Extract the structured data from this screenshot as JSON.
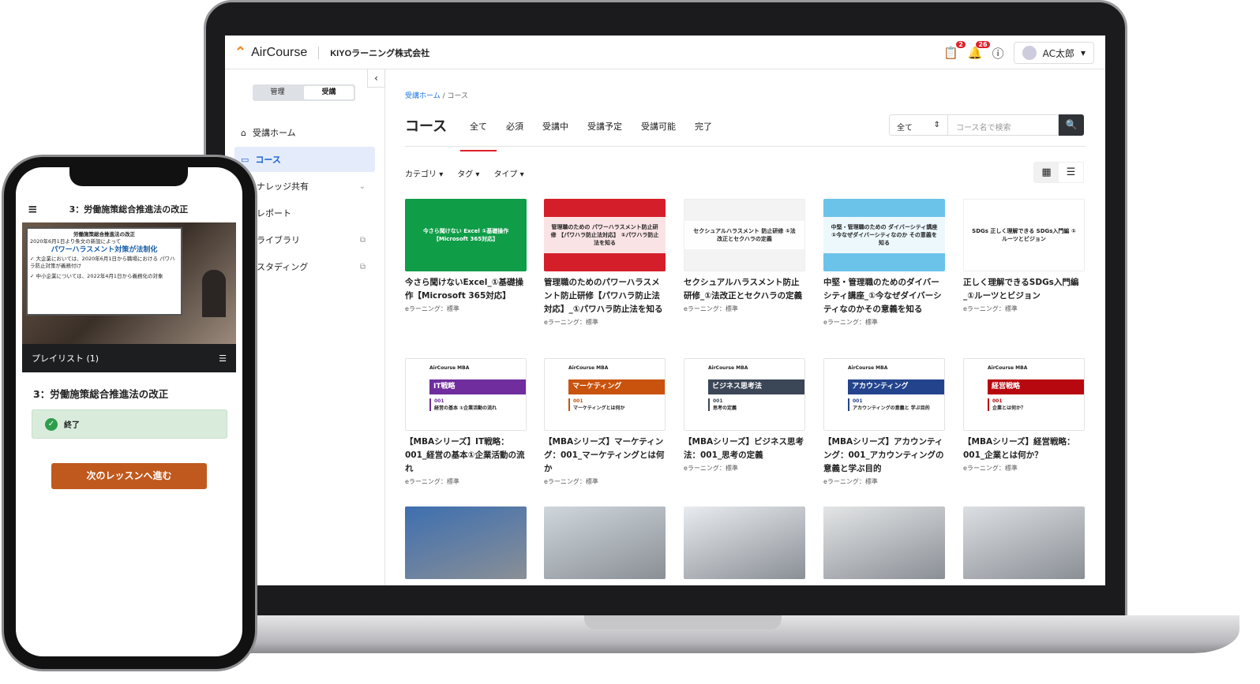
{
  "app": {
    "brand": "AirCourse",
    "company": "KIYOラーニング株式会社",
    "user": "AC太郎",
    "tasks_badge": "2",
    "notifications_badge": "26"
  },
  "sidebar": {
    "mode_admin": "管理",
    "mode_learner": "受講",
    "items": [
      {
        "label": "受講ホーム",
        "icon": "home-icon"
      },
      {
        "label": "コース",
        "icon": "monitor-icon",
        "active": true
      },
      {
        "label": "ナレッジ共有",
        "icon": "chevron-down-icon"
      },
      {
        "label": "レポート"
      },
      {
        "label": "ライブラリ",
        "icon": "external-link-icon"
      },
      {
        "label": "スタディング",
        "icon": "external-link-icon"
      }
    ]
  },
  "main": {
    "breadcrumb": {
      "home": "受講ホーム",
      "current": "コース"
    },
    "title": "コース",
    "tabs": [
      "全て",
      "必須",
      "受講中",
      "受講予定",
      "受講可能",
      "完了"
    ],
    "active_tab": "全て",
    "search": {
      "scope": "全て",
      "placeholder": "コース名で検索"
    },
    "filters": [
      "カテゴリ",
      "タグ",
      "タイプ"
    ],
    "courses": [
      {
        "title": "今さら聞けないExcel_①基礎操作【Microsoft 365対応】",
        "type": "eラーニング：標準",
        "thumb_text": "今さら聞けない Excel ①基礎操作 【Microsoft 365対応】",
        "color": "#0f9d48"
      },
      {
        "title": "管理職のためのパワーハラスメント防止研修【パワハラ防止法対応】_①パワハラ防止法を知る",
        "type": "eラーニング：標準",
        "thumb_text": "管理職のための パワーハラスメント防止研修 【パワハラ防止法対応】 ①パワハラ防止法を知る",
        "color": "#d41f2b"
      },
      {
        "title": "セクシュアルハラスメント防止研修_①法改正とセクハラの定義",
        "type": "eラーニング：標準",
        "thumb_text": "セクシュアルハラスメント 防止研修 ①法改正とセクハラの定義",
        "color": "#f3f3f3"
      },
      {
        "title": "中堅・管理職のためのダイバーシティ講座_①今なぜダイバーシティなのかその意義を知る",
        "type": "eラーニング：標準",
        "thumb_text": "中堅・管理職のための ダイバーシティ講座 ①今なぜダイバーシティなのか その意義を知る",
        "color": "#6cc3ea"
      },
      {
        "title": "正しく理解できるSDGs入門編_①ルーツとビジョン",
        "type": "eラーニング：標準",
        "thumb_text": "SDGs 正しく理解できる SDGs入門編 ①ルーツとビジョン",
        "color": "#ffffff"
      },
      {
        "title": "【MBAシリーズ】IT戦略：001_経営の基本①企業活動の流れ",
        "type": "eラーニング：標準",
        "mba": "IT戦略",
        "num": "001",
        "sub": "経営の基本 ①企業活動の流れ",
        "color": "#6f2d9e"
      },
      {
        "title": "【MBAシリーズ】マーケティング：001_マーケティングとは何か",
        "type": "eラーニング：標準",
        "mba": "マーケティング",
        "num": "001",
        "sub": "マーケティングとは何か",
        "color": "#c9530d"
      },
      {
        "title": "【MBAシリーズ】ビジネス思考法：001_思考の定義",
        "type": "eラーニング：標準",
        "mba": "ビジネス思考法",
        "num": "001",
        "sub": "思考の定義",
        "color": "#3b4656"
      },
      {
        "title": "【MBAシリーズ】アカウンティング：001_アカウンティングの意義と学ぶ目的",
        "type": "eラーニング：標準",
        "mba": "アカウンティング",
        "num": "001",
        "sub": "アカウンティングの意義と 学ぶ目的",
        "color": "#23448c"
      },
      {
        "title": "【MBAシリーズ】経営戦略：001_企業とは何か？",
        "type": "eラーニング：標準",
        "mba": "経営戦略",
        "num": "001",
        "sub": "企業とは何か？",
        "color": "#b8080f"
      }
    ],
    "photo_row_colors": [
      "#3d6fb0",
      "#cfd6dc",
      "#e8ecef",
      "#e3e5e6",
      "#dcdfe2"
    ],
    "mba_logo": "AirCourse MBA"
  },
  "phone": {
    "header_title": "3：労働施策総合推進法の改正",
    "slide": {
      "heading": "労働施策総合推進法の改正",
      "line1": "2020年6月1日より条文の新設によって",
      "headline": "パワーハラスメント対策が法制化",
      "bullet1": "✓ 大企業においては、2020年6月1日から職場における パワハラ防止対策が義務付け",
      "bullet2": "✓ 中小企業については、2022年4月1日から義務化の対象"
    },
    "playlist": "プレイリスト (1)",
    "lesson_title": "3：労働施策総合推進法の改正",
    "status": "終了",
    "next_button": "次のレッスンへ進む"
  }
}
